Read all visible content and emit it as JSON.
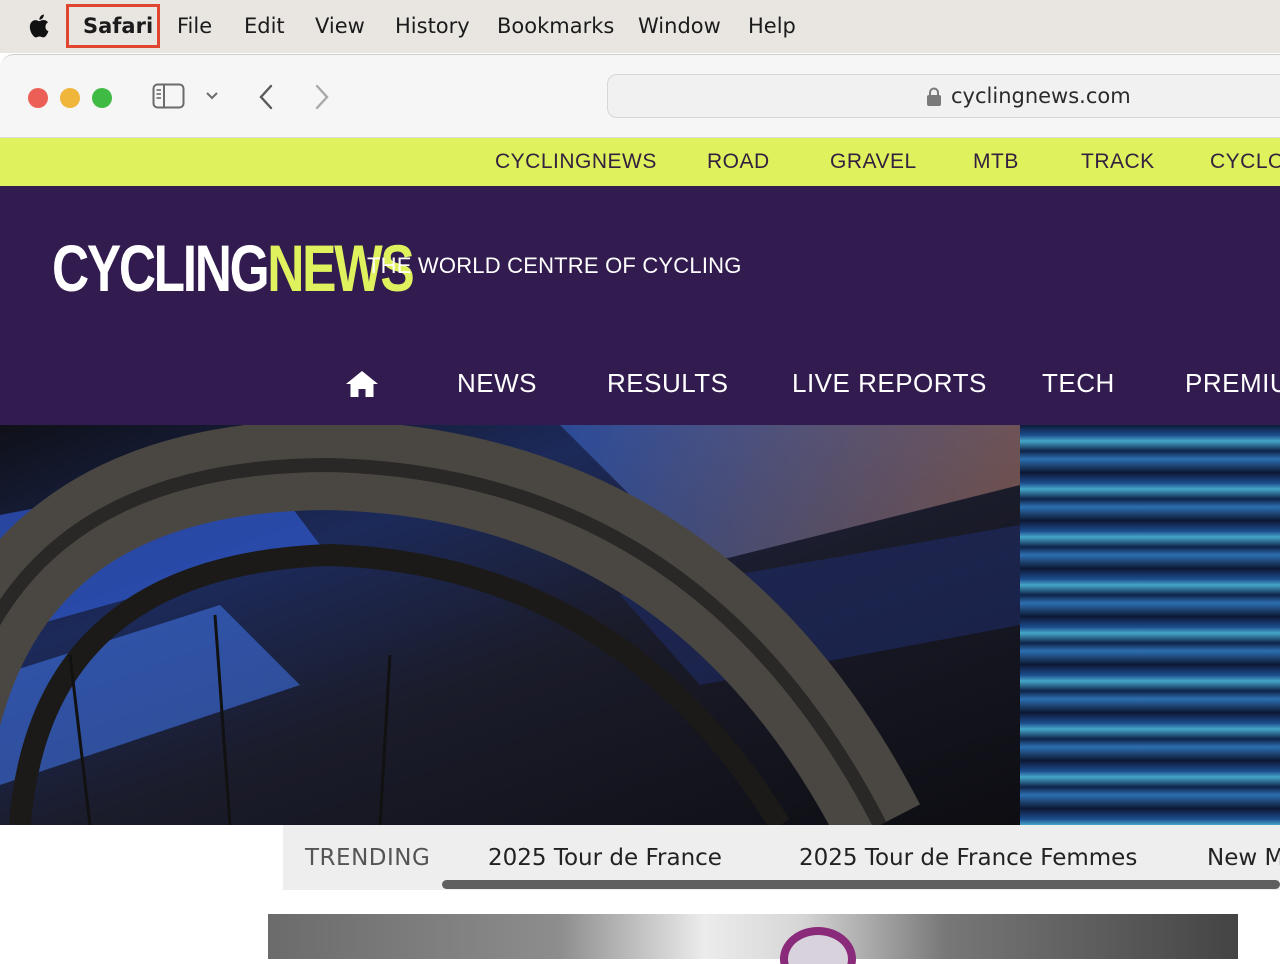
{
  "menubar": {
    "apple_icon": "apple-logo-icon",
    "items": [
      "Safari",
      "File",
      "Edit",
      "View",
      "History",
      "Bookmarks",
      "Window",
      "Help"
    ]
  },
  "toolbar": {
    "url": "cyclingnews.com",
    "icons": [
      "sidebar-icon",
      "chevron-down-icon",
      "back-icon",
      "forward-icon",
      "lock-icon"
    ],
    "traffic_lights": {
      "close": "#ec5f56",
      "minimize": "#f0b63c",
      "zoom": "#3fbb45"
    }
  },
  "site": {
    "top_nav": [
      "CYCLINGNEWS",
      "ROAD",
      "GRAVEL",
      "MTB",
      "TRACK",
      "CYCLO-"
    ],
    "logo_part1": "CYCLING",
    "logo_part2": "NEWS",
    "tagline": "THE WORLD CENTRE OF CYCLING",
    "main_nav": [
      "NEWS",
      "RESULTS",
      "LIVE REPORTS",
      "TECH",
      "PREMIU"
    ],
    "trending_label": "TRENDING",
    "trending_links": [
      "2025 Tour de France",
      "2025 Tour de France Femmes",
      "New M"
    ],
    "colors": {
      "accent": "#dff25d",
      "header_bg": "#321c4f"
    }
  }
}
